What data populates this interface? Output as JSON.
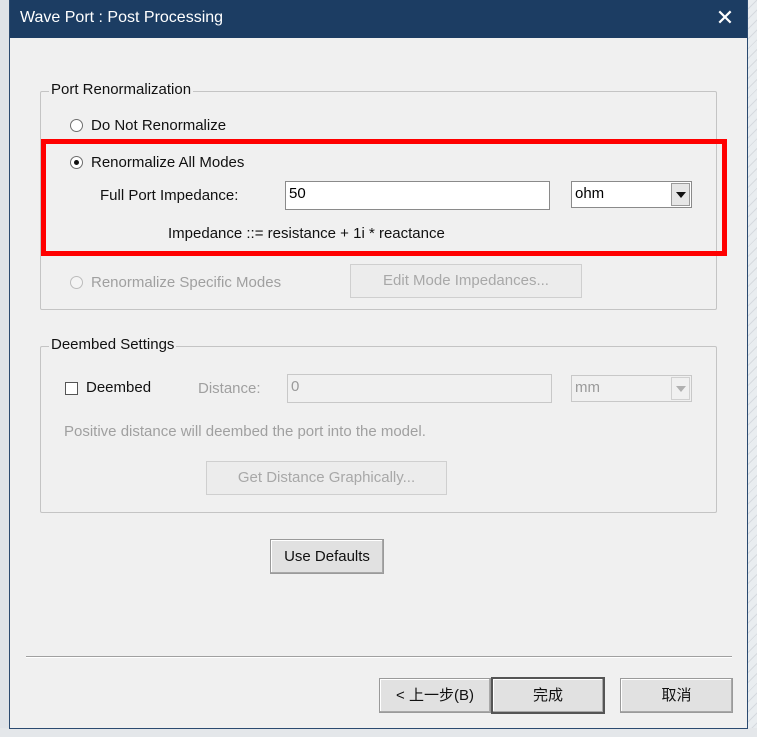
{
  "window": {
    "title": "Wave Port : Post Processing"
  },
  "renormalization": {
    "legend": "Port Renormalization",
    "do_not_label": "Do Not Renormalize",
    "all_modes_label": "Renormalize All Modes",
    "impedance_label": "Full Port Impedance:",
    "impedance_value": "50",
    "unit_value": "ohm",
    "formula": "Impedance ::= resistance + 1i * reactance",
    "specific_label": "Renormalize Specific Modes",
    "edit_button": "Edit Mode Impedances...",
    "selected": "all_modes"
  },
  "deembed": {
    "legend": "Deembed Settings",
    "checkbox_label": "Deembed",
    "checked": false,
    "distance_label": "Distance:",
    "distance_value": "0",
    "unit_value": "mm",
    "note": "Positive distance will deembed the port into the model.",
    "graphical_button": "Get Distance Graphically..."
  },
  "use_defaults_button": "Use Defaults",
  "footer": {
    "back_button": "< 上一步(B)",
    "finish_button": "完成",
    "cancel_button": "取消"
  },
  "highlight_color": "#ff0000"
}
